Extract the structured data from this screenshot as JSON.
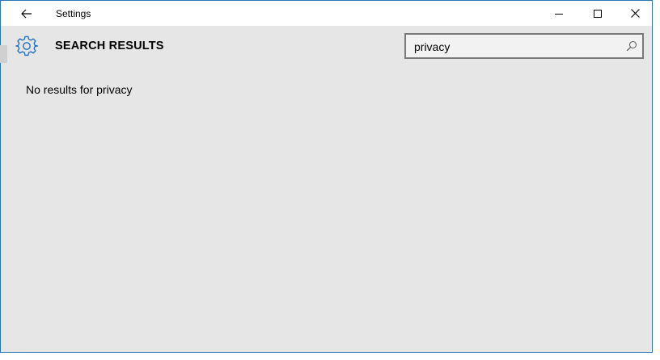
{
  "window": {
    "title": "Settings",
    "accent_color": "#2b74b5"
  },
  "titlebar": {
    "back_icon": "back-arrow-icon",
    "minimize_icon": "minimize-icon",
    "maximize_icon": "maximize-icon",
    "close_icon": "close-icon"
  },
  "header": {
    "icon": "gear-icon",
    "icon_color": "#1e6fc4",
    "title": "SEARCH RESULTS"
  },
  "search": {
    "value": "privacy",
    "icon": "search-icon"
  },
  "main": {
    "message": "No results for privacy"
  }
}
